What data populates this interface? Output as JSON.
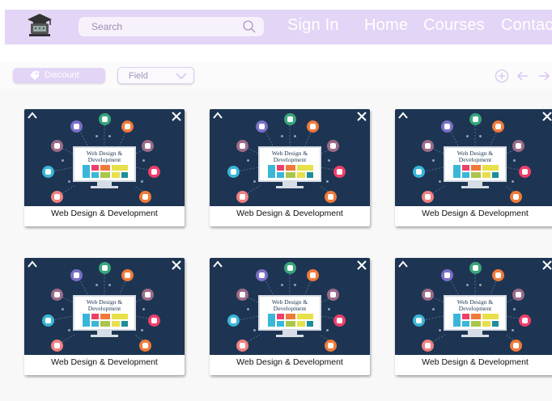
{
  "header": {
    "search": {
      "placeholder": "Search"
    },
    "nav": [
      {
        "label": "Sign In"
      },
      {
        "label": "Home"
      },
      {
        "label": "Courses"
      },
      {
        "label": "Contact"
      }
    ]
  },
  "filters": {
    "discount_label": "Discount",
    "field_label": "Field"
  },
  "cards": [
    {
      "title": "Web Design & Development",
      "screen_line1": "Web Design &",
      "screen_line2": "Development"
    },
    {
      "title": "Web Design & Development",
      "screen_line1": "Web Design &",
      "screen_line2": "Development"
    },
    {
      "title": "Web Design & Development",
      "screen_line1": "Web Design &",
      "screen_line2": "Development"
    },
    {
      "title": "Web Design & Development",
      "screen_line1": "Web Design &",
      "screen_line2": "Development"
    },
    {
      "title": "Web Design & Development",
      "screen_line1": "Web Design &",
      "screen_line2": "Development"
    },
    {
      "title": "Web Design & Development",
      "screen_line1": "Web Design &",
      "screen_line2": "Development"
    }
  ],
  "colors": {
    "header_bg": "#e3d5f6",
    "card_image_bg": "#1d3552",
    "icon_lavender": "#d8c6f4"
  }
}
